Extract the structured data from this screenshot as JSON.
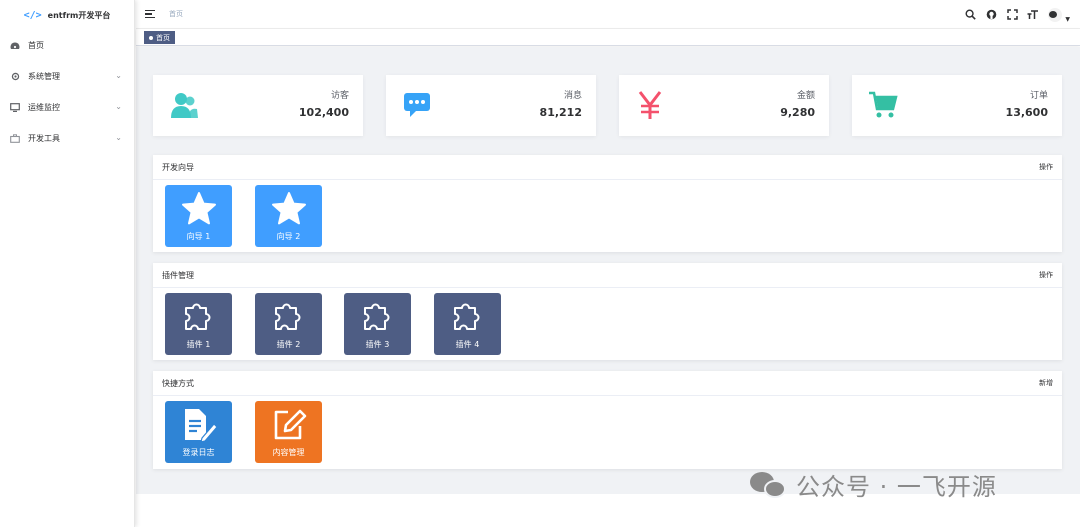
{
  "sidebar": {
    "logo_mark": "</>",
    "logo_text": "entfrm开发平台",
    "items": [
      {
        "label": "首页",
        "icon": "dashboard-icon",
        "has_children": false
      },
      {
        "label": "系统管理",
        "icon": "gear-icon",
        "has_children": true
      },
      {
        "label": "运维监控",
        "icon": "monitor-icon",
        "has_children": true
      },
      {
        "label": "开发工具",
        "icon": "toolbox-icon",
        "has_children": true
      }
    ]
  },
  "header": {
    "breadcrumb": "首页",
    "icons": [
      "search-icon",
      "github-icon",
      "fullscreen-icon",
      "font-size-icon"
    ]
  },
  "tags": {
    "active": "首页"
  },
  "stats": [
    {
      "label": "访客",
      "value": "102,400",
      "icon": "users-icon",
      "color": "#40c9c6"
    },
    {
      "label": "消息",
      "value": "81,212",
      "icon": "message-icon",
      "color": "#36a3f7"
    },
    {
      "label": "金额",
      "value": "9,280",
      "icon": "yen-icon",
      "color": "#f4516c"
    },
    {
      "label": "订单",
      "value": "13,600",
      "icon": "cart-icon",
      "color": "#34bfa3"
    }
  ],
  "panels": [
    {
      "title": "开发向导",
      "action": "操作",
      "tiles": [
        {
          "label": "向导 1",
          "icon": "star-icon",
          "color": "#409eff"
        },
        {
          "label": "向导 2",
          "icon": "star-icon",
          "color": "#409eff"
        }
      ]
    },
    {
      "title": "插件管理",
      "action": "操作",
      "tiles": [
        {
          "label": "插件 1",
          "icon": "puzzle-icon",
          "color": "#4e5d84"
        },
        {
          "label": "插件 2",
          "icon": "puzzle-icon",
          "color": "#4e5d84"
        },
        {
          "label": "插件 3",
          "icon": "puzzle-icon",
          "color": "#4e5d84"
        },
        {
          "label": "插件 4",
          "icon": "puzzle-icon",
          "color": "#4e5d84"
        }
      ]
    },
    {
      "title": "快捷方式",
      "action": "新增",
      "tiles": [
        {
          "label": "登录日志",
          "icon": "document-edit-icon",
          "color": "#2f84d5"
        },
        {
          "label": "内容管理",
          "icon": "edit-icon",
          "color": "#ee7422"
        }
      ]
    }
  ],
  "watermark": {
    "text": "公众号 · 一飞开源",
    "icon": "wechat-icon"
  }
}
